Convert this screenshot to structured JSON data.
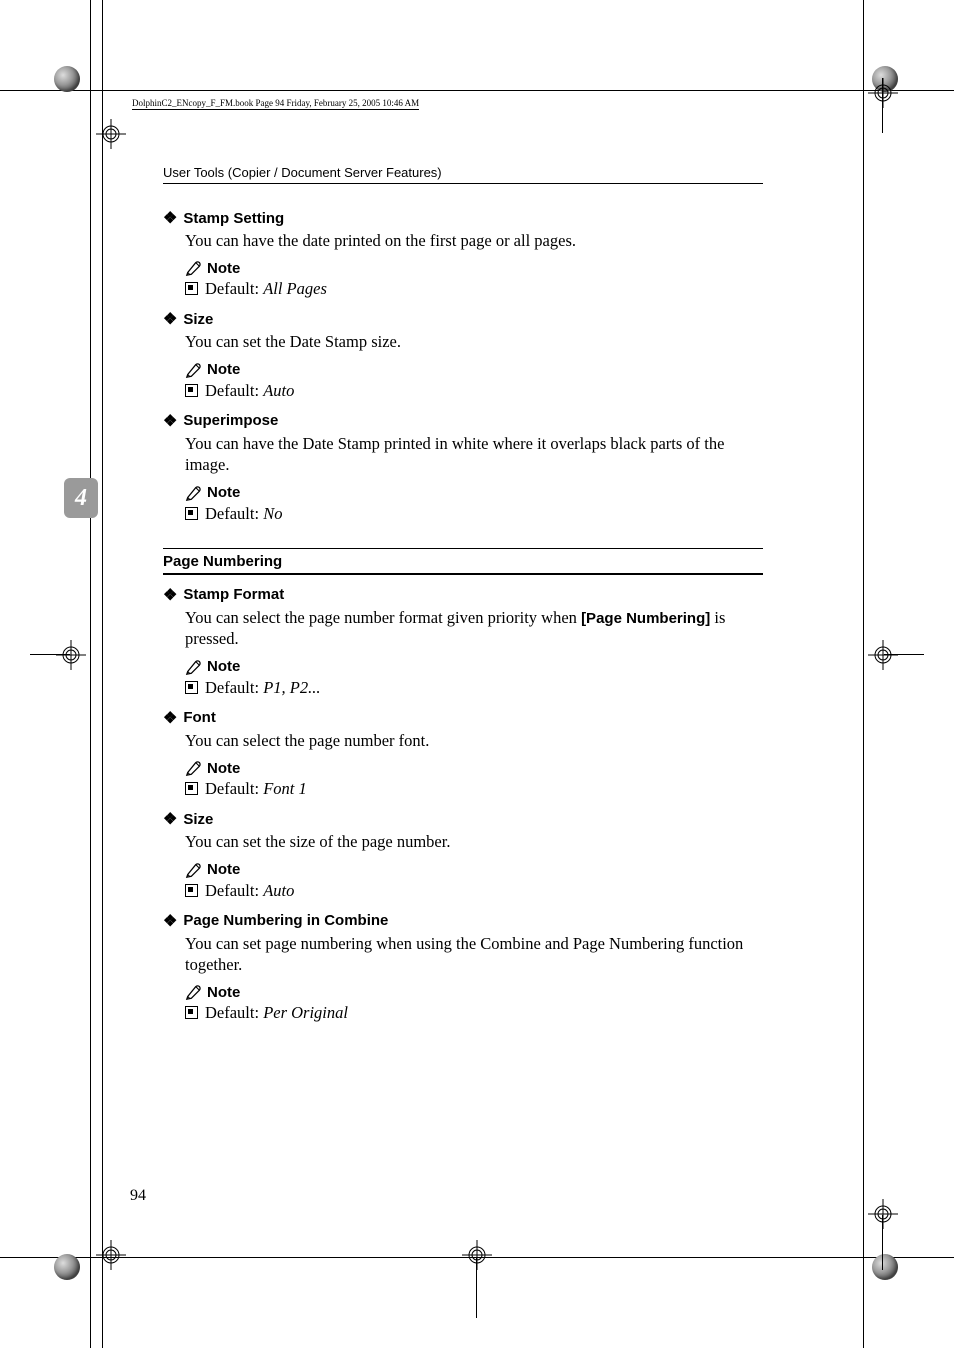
{
  "book_info_line": "DolphinC2_ENcopy_F_FM.book  Page 94  Friday, February 25, 2005  10:46 AM",
  "running_head": "User Tools (Copier / Document Server Features)",
  "side_tab": "4",
  "page_number": "94",
  "sections": {
    "stamp_setting": {
      "title": "Stamp Setting",
      "body": "You can have the date printed on the first page or all pages.",
      "note_label": "Note",
      "default_label": "Default: ",
      "default_value": "All Pages"
    },
    "size1": {
      "title": "Size",
      "body": "You can set the Date Stamp size.",
      "note_label": "Note",
      "default_label": "Default: ",
      "default_value": "Auto"
    },
    "superimpose": {
      "title": "Superimpose",
      "body": "You can have the Date Stamp printed in white where it overlaps black parts of the image.",
      "note_label": "Note",
      "default_label": "Default: ",
      "default_value": "No"
    },
    "page_numbering_head": "Page Numbering",
    "stamp_format": {
      "title": "Stamp Format",
      "body_pre": "You can select the page number format given priority when ",
      "body_bold": "[Page Numbering]",
      "body_post": " is pressed.",
      "note_label": "Note",
      "default_label": "Default: ",
      "default_value": "P1, P2..."
    },
    "font": {
      "title": "Font",
      "body": "You can select the page number font.",
      "note_label": "Note",
      "default_label": "Default: ",
      "default_value": "Font 1"
    },
    "size2": {
      "title": "Size",
      "body": "You can set the size of the page number.",
      "note_label": "Note",
      "default_label": "Default: ",
      "default_value": "Auto"
    },
    "combine": {
      "title": "Page Numbering in Combine",
      "body": "You can set page numbering when using the Combine and Page Numbering function together.",
      "note_label": "Note",
      "default_label": "Default: ",
      "default_value": "Per Original"
    }
  }
}
